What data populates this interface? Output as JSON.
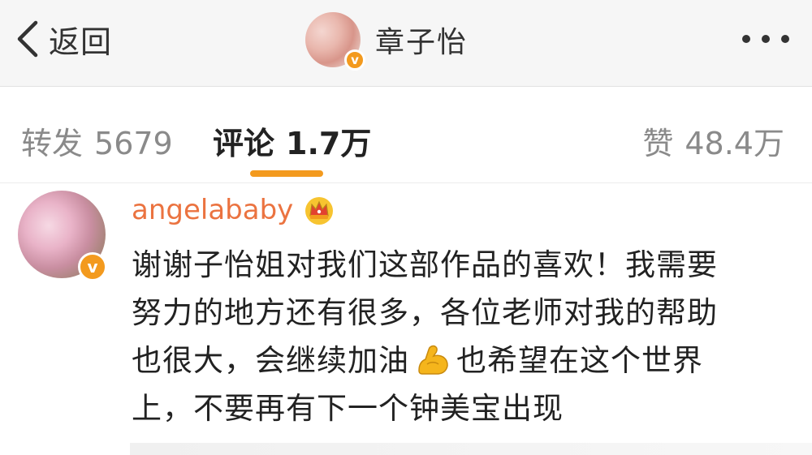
{
  "nav": {
    "back_label": "返回",
    "user_name": "章子怡",
    "badge": "v"
  },
  "tabs": {
    "repost": {
      "label": "转发",
      "count": "5679"
    },
    "comment": {
      "label": "评论",
      "count": "1.7万",
      "active": true
    },
    "like": {
      "label": "赞",
      "count": "48.4万"
    }
  },
  "comment": {
    "author": "angelababy",
    "badge": "v",
    "author_icon": "crown-icon",
    "lines": [
      "谢谢子怡姐对我们这部作品的喜欢！我需要",
      "努力的地方还有很多，各位老师对我的帮助",
      "也很大，会继续加油",
      "也希望在这个世界",
      "上，不要再有下一个钟美宝出现"
    ],
    "emoji_icon": "flexed-biceps-icon"
  },
  "colors": {
    "accent": "#f39a1e",
    "author_name": "#eb7340",
    "nav_bg": "#f6f6f6",
    "muted_text": "#8a8a8a"
  }
}
